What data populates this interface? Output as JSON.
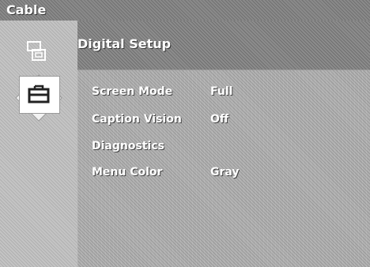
{
  "window": {
    "title": "Cable"
  },
  "section": {
    "title": "Digital Setup"
  },
  "sidebar": {
    "items": [
      {
        "icon": "setup-icon",
        "selected": false
      },
      {
        "icon": "toolbox-icon",
        "selected": true
      }
    ]
  },
  "menu": {
    "items": [
      {
        "label": "Screen Mode",
        "value": "Full"
      },
      {
        "label": "Caption Vision",
        "value": "Off"
      },
      {
        "label": "Diagnostics",
        "value": ""
      },
      {
        "label": "Menu Color",
        "value": "Gray"
      }
    ]
  },
  "colors": {
    "titlebar": "#8a8a8a",
    "panel": "#b2b2b2",
    "text": "#ffffff",
    "selector": "#f2f2f2"
  }
}
